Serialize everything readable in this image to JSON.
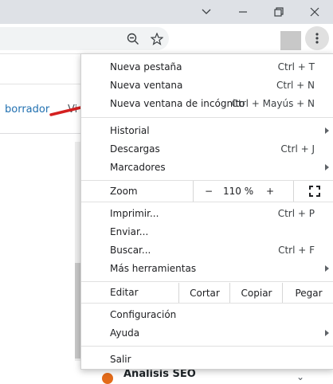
{
  "window": {
    "minimize_icon": "chevron-down-icon",
    "colors": {
      "titlebar": "#dee1e6",
      "menu_bg": "#ffffff",
      "arrow": "#d42020",
      "link": "#2271b1"
    }
  },
  "page": {
    "draft_link": "borrador",
    "truncated_text": "Vi",
    "post_title": "Analisis SEO"
  },
  "menu": {
    "items": [
      {
        "label": "Nueva pestaña",
        "shortcut": "Ctrl + T"
      },
      {
        "label": "Nueva ventana",
        "shortcut": "Ctrl + N"
      },
      {
        "label": "Nueva ventana de incógnito",
        "shortcut": "Ctrl + Mayús + N"
      },
      {
        "label": "Historial",
        "shortcut": ""
      },
      {
        "label": "Descargas",
        "shortcut": "Ctrl + J"
      },
      {
        "label": "Marcadores",
        "shortcut": ""
      },
      {
        "label": "Imprimir...",
        "shortcut": "Ctrl + P"
      },
      {
        "label": "Enviar...",
        "shortcut": ""
      },
      {
        "label": "Buscar...",
        "shortcut": "Ctrl + F"
      },
      {
        "label": "Más herramientas",
        "shortcut": ""
      },
      {
        "label": "Configuración",
        "shortcut": ""
      },
      {
        "label": "Ayuda",
        "shortcut": ""
      },
      {
        "label": "Salir",
        "shortcut": ""
      }
    ],
    "zoom": {
      "label": "Zoom",
      "minus": "−",
      "value": "110 %",
      "plus": "+"
    },
    "edit": {
      "label": "Editar",
      "cut": "Cortar",
      "copy": "Copiar",
      "paste": "Pegar"
    }
  }
}
